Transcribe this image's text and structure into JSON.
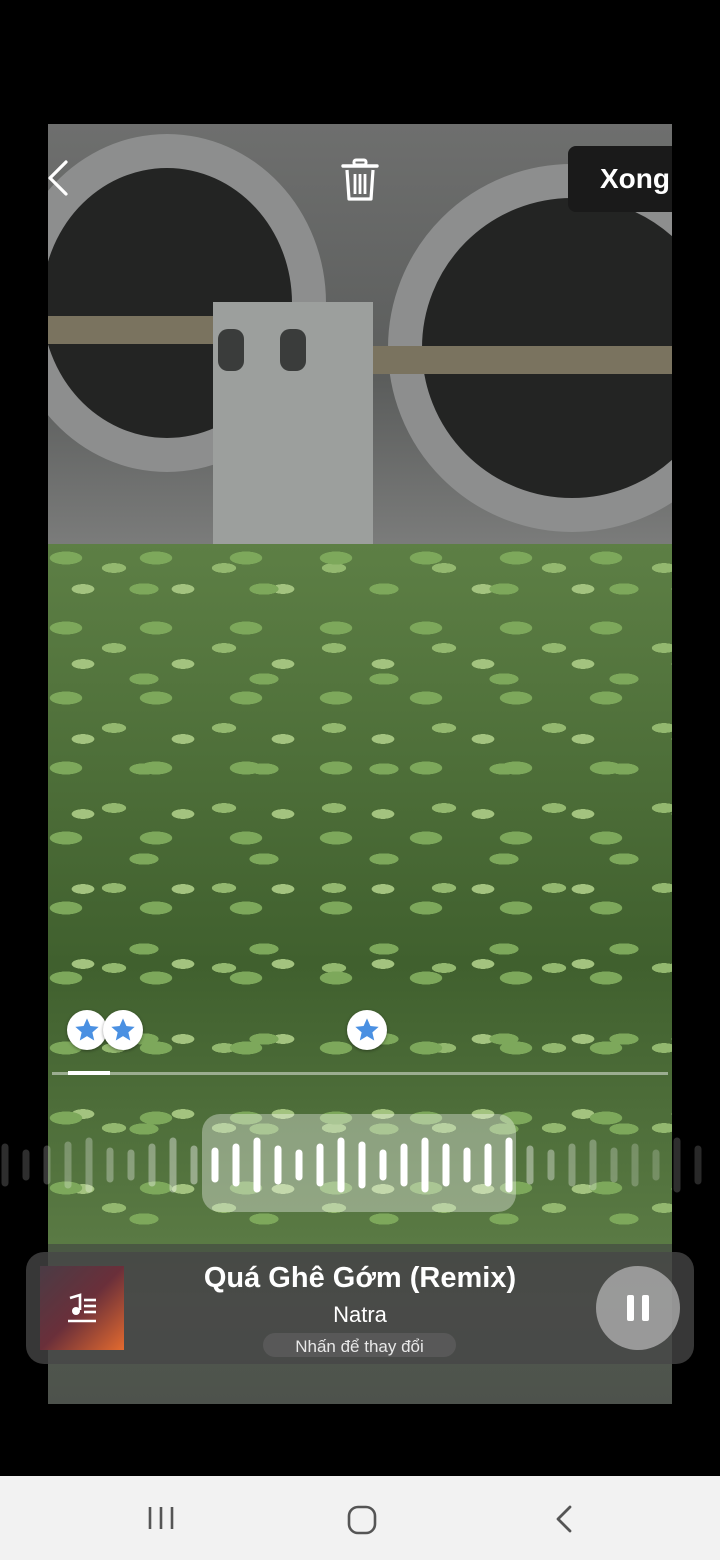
{
  "header": {
    "done_label": "Xong"
  },
  "icons": {
    "back": "chevron-left-icon",
    "delete": "trash-icon"
  },
  "timeline": {
    "markers": [
      "star-marker",
      "star-marker",
      "star-marker"
    ]
  },
  "music": {
    "title": "Quá Ghê Gớm (Remix)",
    "artist": "Natra",
    "change_hint": "Nhấn để thay đổi",
    "state": "playing"
  },
  "colors": {
    "marker_star": "#4a90e2",
    "done_bg": "#1a1a1a",
    "navbar_bg": "#f2f2f2"
  }
}
